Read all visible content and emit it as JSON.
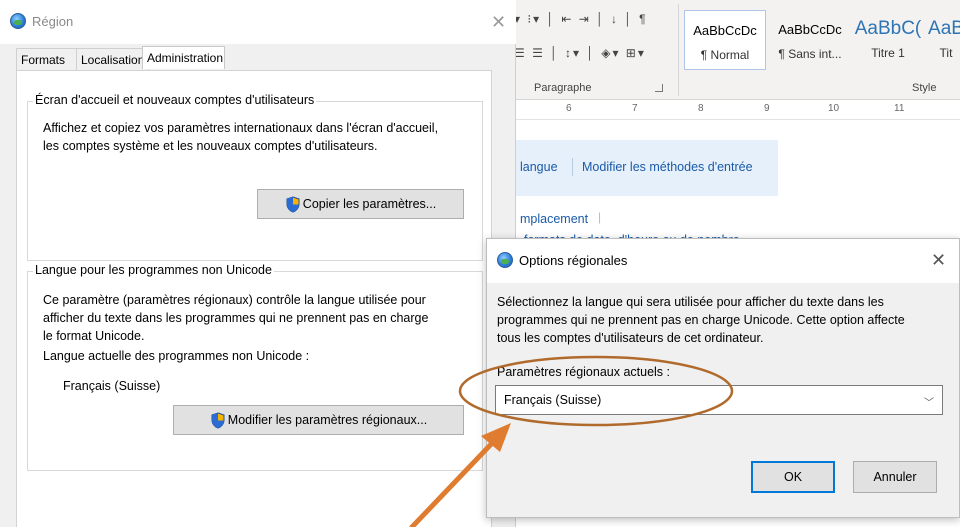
{
  "word": {
    "paragraph_group_label": "Paragraphe",
    "style_group_label": "Style",
    "styles": [
      {
        "sample": "AaBbCcDc",
        "name": "¶ Normal"
      },
      {
        "sample": "AaBbCcDc",
        "name": "¶ Sans int..."
      },
      {
        "sample": "AaBbC(",
        "name": "Titre 1"
      },
      {
        "sample": "AaB",
        "name": "Tit"
      }
    ],
    "ruler_numbers": [
      "6",
      "7",
      "8",
      "9",
      "10",
      "11"
    ],
    "links": {
      "language": "langue",
      "input_methods": "Modifier les méthodes d'entrée",
      "location": "mplacement",
      "formats": "formats de date, d'heure ou de nombre"
    }
  },
  "region": {
    "title": "Région",
    "tabs": [
      "Formats",
      "Localisation",
      "Administration"
    ],
    "welcome": {
      "legend": "Écran d'accueil et nouveaux comptes d'utilisateurs",
      "text_line1": "Affichez et copiez vos paramètres internationaux dans l'écran d'accueil,",
      "text_line2": "les comptes système et les nouveaux comptes d'utilisateurs.",
      "button": "Copier les paramètres..."
    },
    "unicode": {
      "legend": "Langue pour les programmes non Unicode",
      "text_line1": "Ce paramètre (paramètres régionaux) contrôle la langue utilisée pour",
      "text_line2": "afficher du texte dans les programmes qui ne prennent pas en charge",
      "text_line3": "le format Unicode.",
      "current_label": "Langue actuelle des programmes non Unicode :",
      "current_value": "Français (Suisse)",
      "button": "Modifier les paramètres régionaux..."
    }
  },
  "options": {
    "title": "Options régionales",
    "desc_line1": "Sélectionnez la langue qui sera utilisée pour afficher du texte dans les",
    "desc_line2": "programmes qui ne prennent pas en charge Unicode. Cette option affecte",
    "desc_line3": "tous les comptes d'utilisateurs de cet ordinateur.",
    "field_label": "Paramètres régionaux actuels :",
    "selected": "Français (Suisse)",
    "ok": "OK",
    "cancel": "Annuler"
  },
  "annotation_color": "#e07c2f",
  "link_color": "#1a5aa8"
}
